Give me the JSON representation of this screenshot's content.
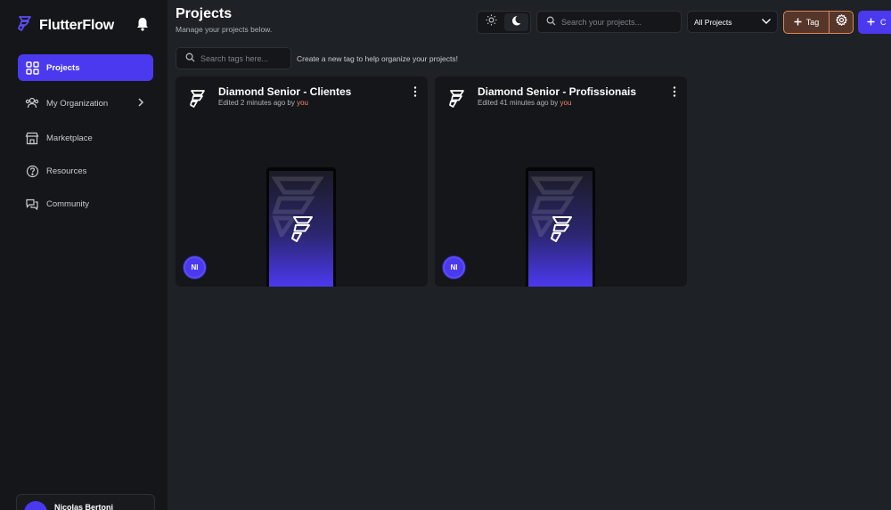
{
  "app": {
    "name": "FlutterFlow"
  },
  "sidebar": {
    "items": [
      {
        "label": "Projects",
        "icon": "grid-icon",
        "active": true
      },
      {
        "label": "My Organization",
        "icon": "people-icon",
        "has_chevron": true
      },
      {
        "label": "Marketplace",
        "icon": "store-icon"
      },
      {
        "label": "Resources",
        "icon": "help-circle-icon"
      },
      {
        "label": "Community",
        "icon": "chat-icon"
      }
    ],
    "user": {
      "name": "Nicolas Bertoni"
    }
  },
  "header": {
    "title": "Projects",
    "subtitle": "Manage your projects below."
  },
  "toolbar": {
    "search_placeholder": "Search your projects...",
    "filter_selected": "All Projects",
    "tag_label": "Tag",
    "create_label": "C"
  },
  "tags": {
    "search_placeholder": "Search tags here...",
    "hint": "Create a new tag to help organize your projects!"
  },
  "projects": [
    {
      "title": "Diamond Senior - Clientes",
      "edited": "Edited 2 minutes ago by",
      "by": "you",
      "owner_initials": "NI"
    },
    {
      "title": "Diamond Senior - Profissionais",
      "edited": "Edited 41 minutes ago by",
      "by": "you",
      "owner_initials": "NI"
    }
  ],
  "colors": {
    "primary": "#4b39ef",
    "accent": "#ee8b60",
    "background": "#1e2125",
    "surface": "#141619"
  }
}
